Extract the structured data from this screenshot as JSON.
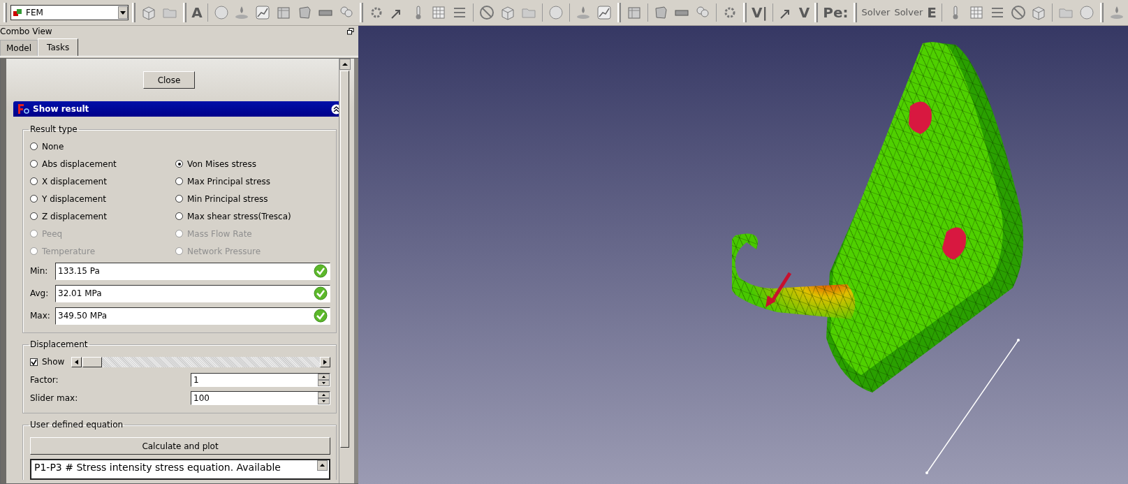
{
  "toolbar": {
    "workbench": "FEM",
    "groups": [
      [
        {
          "kind": "icon"
        },
        {
          "kind": "icon"
        }
      ],
      [
        {
          "kind": "text",
          "label": "A"
        },
        {
          "kind": "sep"
        },
        {
          "kind": "icon"
        },
        {
          "kind": "icon"
        },
        {
          "kind": "icon"
        },
        {
          "kind": "icon"
        },
        {
          "kind": "icon"
        },
        {
          "kind": "icon"
        },
        {
          "kind": "icon"
        }
      ],
      [
        {
          "kind": "icon"
        },
        {
          "kind": "icon"
        },
        {
          "kind": "icon"
        },
        {
          "kind": "icon"
        },
        {
          "kind": "icon"
        },
        {
          "kind": "sep"
        },
        {
          "kind": "icon"
        },
        {
          "kind": "icon"
        },
        {
          "kind": "icon"
        },
        {
          "kind": "sep"
        },
        {
          "kind": "icon"
        },
        {
          "kind": "sep"
        },
        {
          "kind": "icon"
        },
        {
          "kind": "icon"
        }
      ],
      [
        {
          "kind": "icon"
        },
        {
          "kind": "sep"
        },
        {
          "kind": "icon"
        },
        {
          "kind": "icon"
        },
        {
          "kind": "icon"
        },
        {
          "kind": "sep"
        },
        {
          "kind": "icon"
        }
      ],
      [
        {
          "kind": "text",
          "label": "V|"
        },
        {
          "kind": "sep"
        },
        {
          "kind": "icon"
        },
        {
          "kind": "text",
          "label": "V"
        }
      ],
      [
        {
          "kind": "text",
          "label": "Pe:"
        }
      ],
      [
        {
          "kind": "text",
          "label": "Solver"
        },
        {
          "kind": "text",
          "label": "Solver"
        },
        {
          "kind": "text",
          "label": "E"
        },
        {
          "kind": "sep"
        },
        {
          "kind": "icon"
        },
        {
          "kind": "icon"
        },
        {
          "kind": "icon"
        },
        {
          "kind": "icon"
        },
        {
          "kind": "icon"
        },
        {
          "kind": "sep"
        },
        {
          "kind": "icon"
        },
        {
          "kind": "icon"
        }
      ],
      [
        {
          "kind": "icon"
        }
      ]
    ]
  },
  "combo_view": {
    "title": "Combo View",
    "tabs": [
      {
        "label": "Model",
        "selected": false
      },
      {
        "label": "Tasks",
        "selected": true
      }
    ]
  },
  "close_button": "Close",
  "task_panel": {
    "title": "Show result",
    "expanded": true,
    "result_type": {
      "title": "Result type",
      "rows": [
        [
          {
            "label": "None",
            "selected": false,
            "disabled": false
          }
        ],
        [
          {
            "label": "Abs displacement",
            "selected": false,
            "disabled": false
          },
          {
            "label": "Von Mises stress",
            "selected": true,
            "disabled": false
          }
        ],
        [
          {
            "label": "X displacement",
            "selected": false,
            "disabled": false
          },
          {
            "label": "Max Principal stress",
            "selected": false,
            "disabled": false
          }
        ],
        [
          {
            "label": "Y displacement",
            "selected": false,
            "disabled": false
          },
          {
            "label": "Min Principal stress",
            "selected": false,
            "disabled": false
          }
        ],
        [
          {
            "label": "Z displacement",
            "selected": false,
            "disabled": false
          },
          {
            "label": "Max shear stress(Tresca)",
            "selected": false,
            "disabled": false
          }
        ],
        [
          {
            "label": "Peeq",
            "selected": false,
            "disabled": true
          },
          {
            "label": "Mass Flow Rate",
            "selected": false,
            "disabled": true
          }
        ],
        [
          {
            "label": "Temperature",
            "selected": false,
            "disabled": true
          },
          {
            "label": "Network Pressure",
            "selected": false,
            "disabled": true
          }
        ]
      ],
      "values": [
        {
          "label": "Min:",
          "value": "133.15 Pa"
        },
        {
          "label": "Avg:",
          "value": "32.01 MPa"
        },
        {
          "label": "Max:",
          "value": "349.50 MPa"
        }
      ]
    },
    "displacement": {
      "title": "Displacement",
      "show": {
        "label": "Show",
        "checked": true
      },
      "slider": {
        "level": 0
      },
      "fields": [
        {
          "label": "Factor:",
          "value": "1"
        },
        {
          "label": "Slider max:",
          "value": "100"
        }
      ]
    },
    "equation": {
      "title": "User defined equation",
      "button": "Calculate and plot",
      "text": "P1-P3 # Stress intensity stress equation. Available"
    }
  }
}
